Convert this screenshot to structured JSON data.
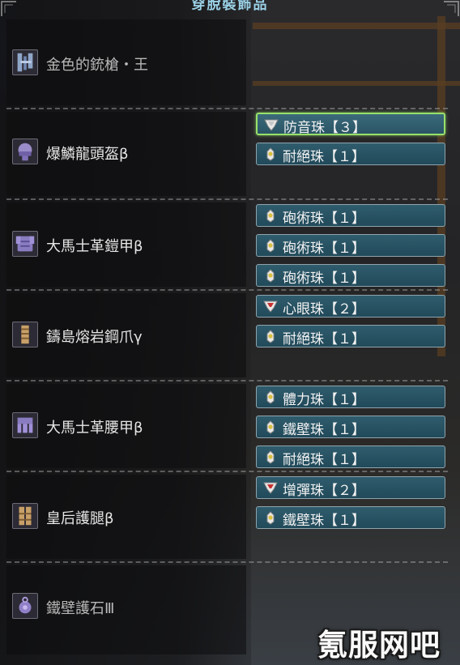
{
  "header": {
    "title": "穿脫裝飾品"
  },
  "equipment": [
    {
      "name": "金色的銃槍・王",
      "icon": "gunlance-icon",
      "dim": true,
      "slots": []
    },
    {
      "name": "爆鱗龍頭盔β",
      "icon": "helmet-icon",
      "dim": false,
      "slots": [
        {
          "label": "防音珠【３】",
          "level": 3,
          "selected": true
        },
        {
          "label": "耐絕珠【１】",
          "level": 1,
          "selected": false
        }
      ]
    },
    {
      "name": "大馬士革鎧甲β",
      "icon": "chest-armor-icon",
      "dim": false,
      "slots": [
        {
          "label": "砲術珠【１】",
          "level": 1,
          "selected": false
        },
        {
          "label": "砲術珠【１】",
          "level": 1,
          "selected": false
        },
        {
          "label": "砲術珠【１】",
          "level": 1,
          "selected": false
        }
      ]
    },
    {
      "name": "鑄島熔岩鋼爪γ",
      "icon": "gauntlet-icon",
      "dim": false,
      "slots": [
        {
          "label": "心眼珠【２】",
          "level": 2,
          "selected": false
        },
        {
          "label": "耐絕珠【１】",
          "level": 1,
          "selected": false
        }
      ]
    },
    {
      "name": "大馬士革腰甲β",
      "icon": "waist-armor-icon",
      "dim": false,
      "slots": [
        {
          "label": "體力珠【１】",
          "level": 1,
          "selected": false
        },
        {
          "label": "鐵壁珠【１】",
          "level": 1,
          "selected": false
        },
        {
          "label": "耐絕珠【１】",
          "level": 1,
          "selected": false
        }
      ]
    },
    {
      "name": "皇后護腿β",
      "icon": "leg-armor-icon",
      "dim": false,
      "slots": [
        {
          "label": "增彈珠【２】",
          "level": 2,
          "selected": false
        },
        {
          "label": "鐵壁珠【１】",
          "level": 1,
          "selected": false
        }
      ]
    },
    {
      "name": "鐵壁護石Ⅲ",
      "icon": "charm-icon",
      "dim": true,
      "slots": []
    }
  ],
  "watermark": "氪服网吧",
  "colors": {
    "slot_fill": "#2a5566",
    "slot_selected_border": "#98e06a",
    "header_text": "#9ad1e6",
    "gem_level1": "#d8c040",
    "gem_level2": "#c83030",
    "gem_level3": "#c8c8c8"
  }
}
